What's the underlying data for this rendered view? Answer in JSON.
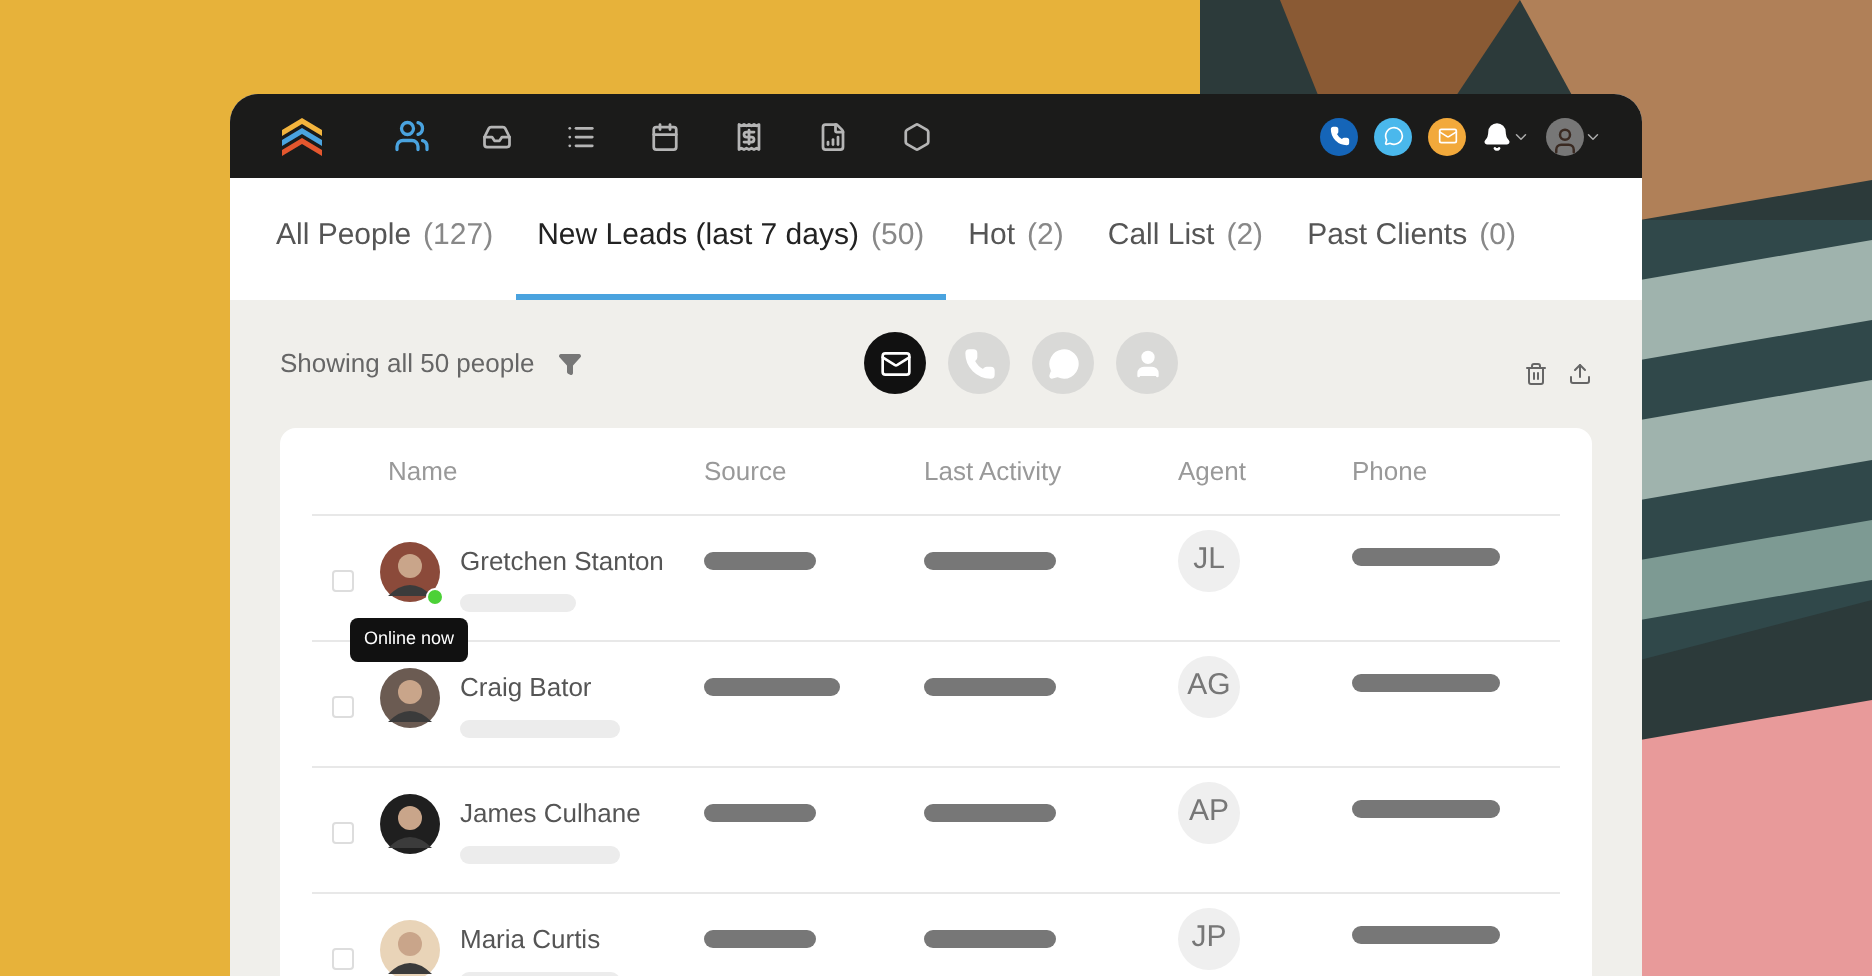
{
  "nav": {
    "items": [
      {
        "kind": "people",
        "selected": true
      },
      {
        "kind": "inbox",
        "selected": false
      },
      {
        "kind": "tasks",
        "selected": false
      },
      {
        "kind": "calendar",
        "selected": false
      },
      {
        "kind": "deals",
        "selected": false
      },
      {
        "kind": "reports",
        "selected": false
      },
      {
        "kind": "admin",
        "selected": false
      }
    ]
  },
  "tabs": [
    {
      "label": "All People",
      "count": "(127)",
      "selected": false
    },
    {
      "label": "New Leads (last 7 days)",
      "count": "(50)",
      "selected": true
    },
    {
      "label": "Hot",
      "count": "(2)",
      "selected": false
    },
    {
      "label": "Call List",
      "count": "(2)",
      "selected": false
    },
    {
      "label": "Past Clients",
      "count": "(0)",
      "selected": false
    }
  ],
  "toolbar": {
    "summary": "Showing all 50 people",
    "channels": [
      {
        "kind": "email",
        "selected": true
      },
      {
        "kind": "call",
        "selected": false
      },
      {
        "kind": "text",
        "selected": false
      },
      {
        "kind": "profile",
        "selected": false
      }
    ]
  },
  "table": {
    "columns": [
      "Name",
      "Source",
      "Last Activity",
      "Agent",
      "Phone"
    ],
    "rows": [
      {
        "name": "Gretchen Stanton",
        "agent": "JL",
        "online": true,
        "tooltip": "Online now",
        "checked": false
      },
      {
        "name": "Craig Bator",
        "agent": "AG",
        "online": false,
        "checked": false
      },
      {
        "name": "James Culhane",
        "agent": "AP",
        "online": false,
        "checked": false
      },
      {
        "name": "Maria Curtis",
        "agent": "JP",
        "online": false,
        "checked": false
      }
    ]
  }
}
